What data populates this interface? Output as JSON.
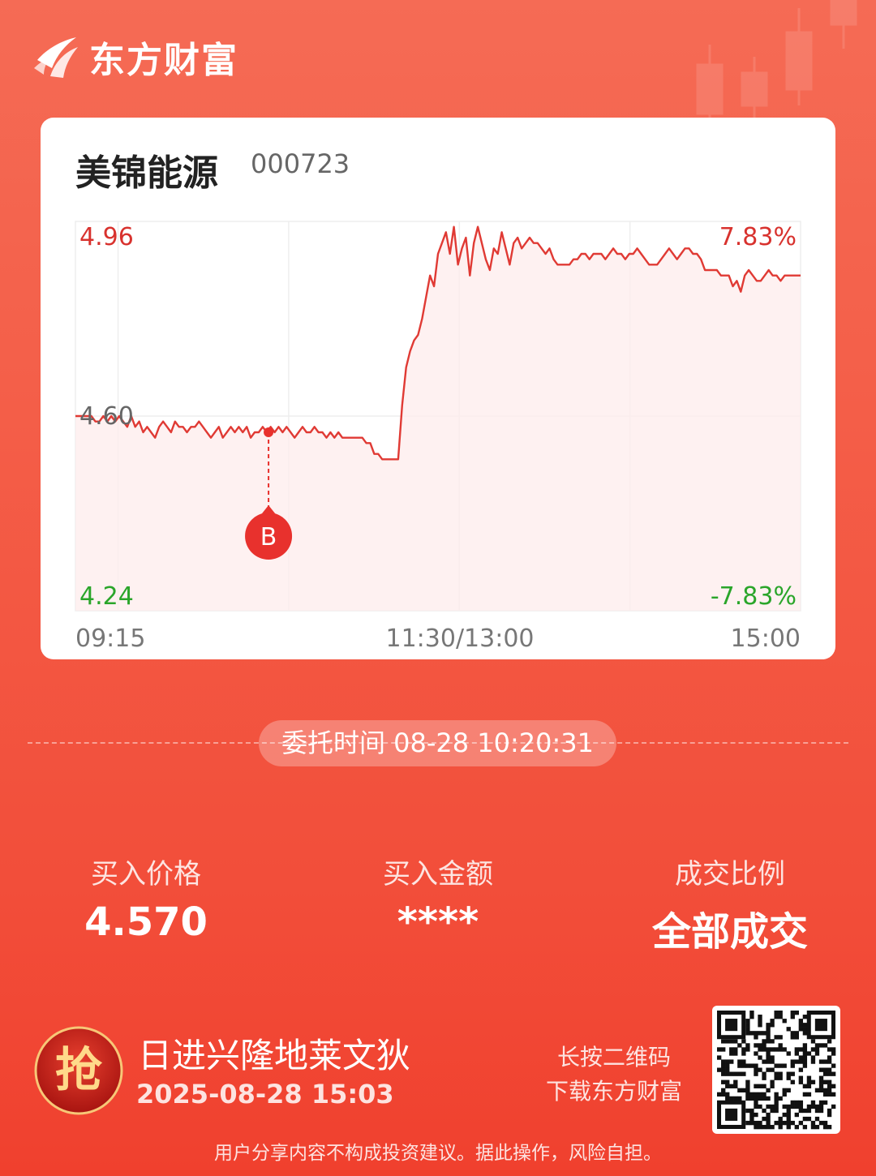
{
  "header": {
    "brand_name": "东方财富"
  },
  "card": {
    "stock_name": "美锦能源",
    "stock_code": "000723",
    "price_high": "4.96",
    "price_mid": "4.60",
    "price_low": "4.24",
    "pct_high": "7.83%",
    "pct_low": "-7.83%",
    "time_start": "09:15",
    "time_mid": "11:30/13:00",
    "time_end": "15:00",
    "marker_label": "B"
  },
  "chart_data": {
    "type": "line",
    "x_label_ticks": [
      "09:15",
      "11:30/13:00",
      "15:00"
    ],
    "ylim": [
      4.24,
      4.96
    ],
    "y_ticks": [
      "4.24",
      "4.60",
      "4.96"
    ],
    "pct_ticks": [
      "-7.83%",
      "7.83%"
    ],
    "grid": true,
    "series": [
      {
        "values": [
          4.6,
          4.6,
          4.6,
          4.6,
          4.6,
          4.59,
          4.59,
          4.6,
          4.59,
          4.6,
          4.59,
          4.6,
          4.59,
          4.58,
          4.6,
          4.58,
          4.59,
          4.57,
          4.58,
          4.57,
          4.56,
          4.58,
          4.59,
          4.58,
          4.57,
          4.59,
          4.58,
          4.58,
          4.57,
          4.58,
          4.58,
          4.59,
          4.58,
          4.57,
          4.56,
          4.57,
          4.58,
          4.56,
          4.57,
          4.58,
          4.57,
          4.58,
          4.57,
          4.58,
          4.56,
          4.57,
          4.57,
          4.58,
          4.57,
          4.58,
          4.57,
          4.58,
          4.57,
          4.58,
          4.57,
          4.56,
          4.57,
          4.58,
          4.57,
          4.57,
          4.58,
          4.57,
          4.57,
          4.56,
          4.57,
          4.56,
          4.57,
          4.56,
          4.56,
          4.56,
          4.56,
          4.56,
          4.56,
          4.55,
          4.55,
          4.53,
          4.53,
          4.52,
          4.52,
          4.52,
          4.52,
          4.52,
          4.62,
          4.69,
          4.72,
          4.74,
          4.75,
          4.78,
          4.82,
          4.86,
          4.84,
          4.9,
          4.92,
          4.94,
          4.9,
          4.95,
          4.88,
          4.91,
          4.93,
          4.86,
          4.92,
          4.95,
          4.92,
          4.89,
          4.87,
          4.91,
          4.9,
          4.94,
          4.91,
          4.88,
          4.92,
          4.93,
          4.91,
          4.92,
          4.93,
          4.92,
          4.92,
          4.91,
          4.9,
          4.91,
          4.89,
          4.88,
          4.88,
          4.88,
          4.88,
          4.89,
          4.89,
          4.9,
          4.9,
          4.89,
          4.9,
          4.9,
          4.9,
          4.89,
          4.9,
          4.91,
          4.9,
          4.9,
          4.89,
          4.9,
          4.9,
          4.91,
          4.9,
          4.89,
          4.88,
          4.88,
          4.88,
          4.89,
          4.9,
          4.91,
          4.9,
          4.89,
          4.9,
          4.91,
          4.91,
          4.9,
          4.9,
          4.89,
          4.87,
          4.87,
          4.87,
          4.87,
          4.86,
          4.86,
          4.86,
          4.84,
          4.85,
          4.83,
          4.86,
          4.87,
          4.86,
          4.85,
          4.85,
          4.86,
          4.87,
          4.86,
          4.86,
          4.85,
          4.86,
          4.86,
          4.86,
          4.86,
          4.86
        ]
      }
    ],
    "marker": {
      "label": "B",
      "time": "10:20",
      "value": 4.57
    }
  },
  "entrust": {
    "text": "委托时间 08-28 10:20:31"
  },
  "stats": [
    {
      "label": "买入价格",
      "value": "4.570"
    },
    {
      "label": "买入金额",
      "value": "****"
    },
    {
      "label": "成交比例",
      "value": "全部成交"
    }
  ],
  "footer": {
    "icon_label": "抢",
    "user_name": "日进兴隆地莱文狄",
    "timestamp": "2025-08-28 15:03",
    "qr_hint_line1": "长按二维码",
    "qr_hint_line2": "下载东方财富",
    "disclaimer": "用户分享内容不构成投资建议。据此操作，风险自担。"
  },
  "colors": {
    "accent_red": "#e8312d",
    "up_red": "#e03a34",
    "down_green": "#2aa52a",
    "background": "#f4604a"
  }
}
